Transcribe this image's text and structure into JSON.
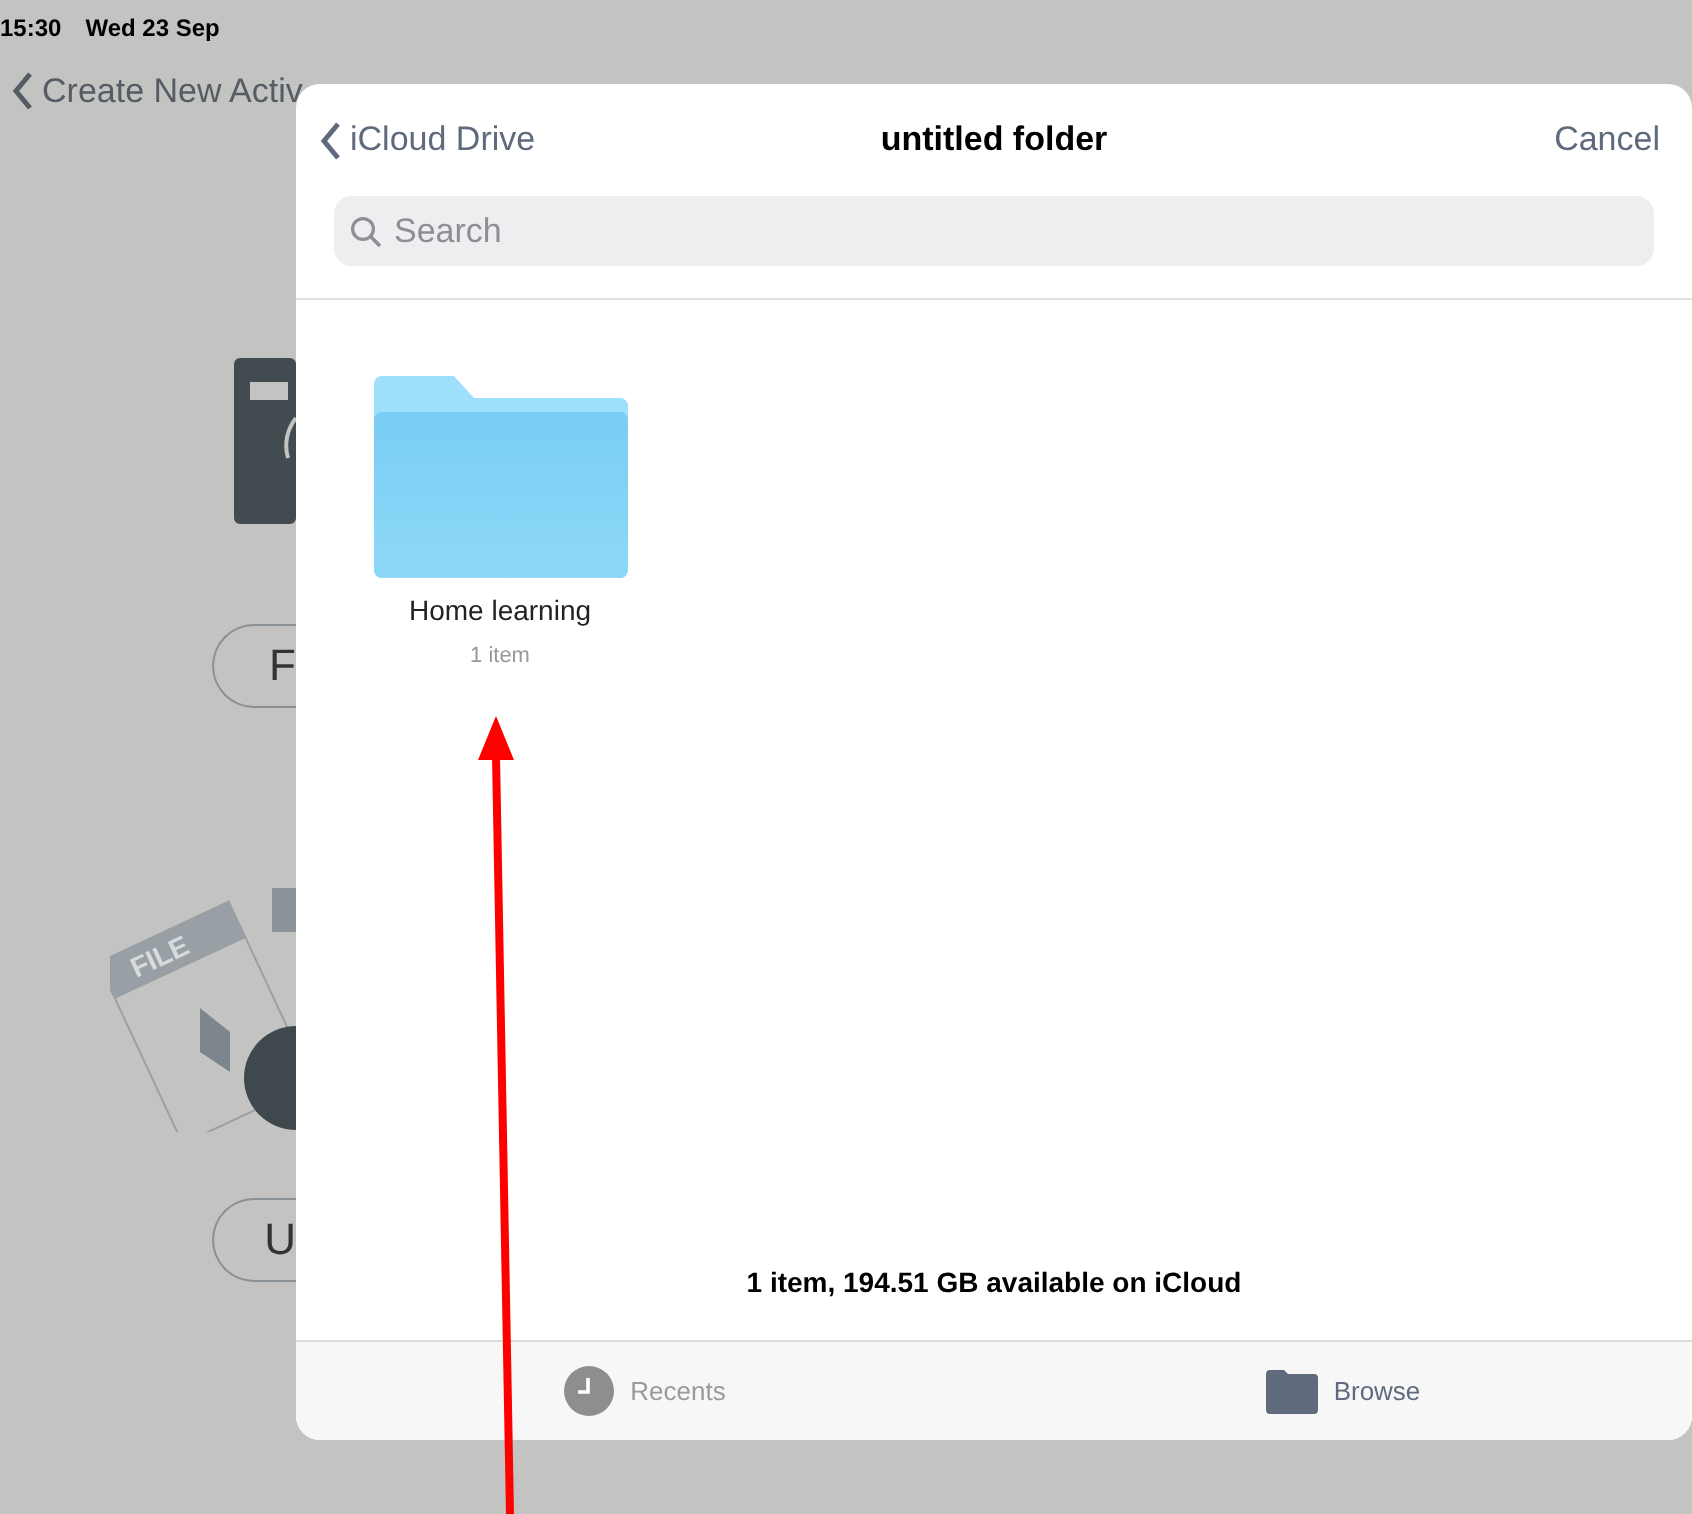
{
  "status_bar": {
    "time": "15:30",
    "date": "Wed 23 Sep"
  },
  "background": {
    "back_link": "Create New Activ",
    "illustration_label": "FILE",
    "buttons": [
      "F",
      "U"
    ]
  },
  "picker": {
    "back": "iCloud Drive",
    "title": "untitled folder",
    "cancel": "Cancel",
    "search": {
      "placeholder": "Search"
    },
    "items": [
      {
        "name": "Home learning",
        "count": "1 item"
      }
    ],
    "footer": "1 item, 194.51 GB available on iCloud",
    "tabs": [
      {
        "label": "Recents",
        "kind": "recents",
        "selected": false
      },
      {
        "label": "Browse",
        "kind": "browse",
        "selected": true
      }
    ]
  }
}
